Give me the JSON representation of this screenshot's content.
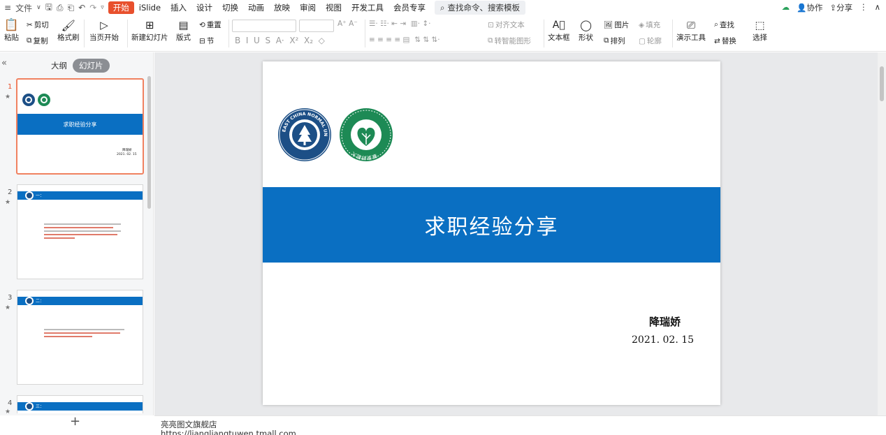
{
  "menubar": {
    "file_menu": "文件",
    "tabs": [
      "开始",
      "iSlide",
      "插入",
      "设计",
      "切换",
      "动画",
      "放映",
      "审阅",
      "视图",
      "开发工具",
      "会员专享"
    ],
    "active_tab": "开始",
    "search_placeholder": "查找命令、搜索模板",
    "collab_label": "协作",
    "share_label": "分享"
  },
  "ribbon": {
    "paste": "粘贴",
    "cut": "剪切",
    "copy": "复制",
    "format_painter": "格式刷",
    "from_current": "当页开始",
    "new_slide": "新建幻灯片",
    "layout": "版式",
    "section": "节",
    "reset": "重置",
    "align_text": "对齐文本",
    "smart_art": "转智能图形",
    "text_box": "文本框",
    "shape": "形状",
    "arrange": "排列",
    "picture": "图片",
    "fill": "填充",
    "outline": "轮廓",
    "present_tools": "演示工具",
    "find": "查找",
    "replace": "替换",
    "select": "选择"
  },
  "leftpanel": {
    "tab_outline": "大纲",
    "tab_slides": "幻灯片",
    "thumbs": [
      {
        "number": "1",
        "title": "求职经验分享",
        "author": "降瑞娇",
        "date": "2021. 02. 15"
      },
      {
        "number": "2",
        "heading": "一："
      },
      {
        "number": "3",
        "heading": "二："
      },
      {
        "number": "4",
        "heading": "三："
      }
    ]
  },
  "slide": {
    "title": "求职经验分享",
    "author": "降瑞娇",
    "date": "2021. 02. 15",
    "logo1_text": "EAST CHINA NORMAL UNIVERSITY",
    "logo2_text": "華東師範大學"
  },
  "notes": {
    "line1": "亮亮图文旗舰店",
    "line2": "https://liangliangtuwen.tmall.com"
  },
  "colors": {
    "accent": "#e8502d",
    "slide_blue": "#0a6fc2",
    "logo_green": "#1d8a55",
    "logo_navy": "#1c4f86"
  }
}
